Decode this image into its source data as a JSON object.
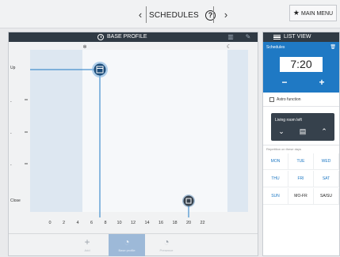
{
  "header": {
    "title": "SCHEDULES",
    "main_menu_label": "MAIN MENU",
    "prev_icon": "chevron-left-icon",
    "next_icon": "chevron-right-icon",
    "help_icon": "question-circle-icon",
    "star_icon": "star-icon"
  },
  "profile_panel": {
    "title": "BASE PROFILE",
    "y_labels": [
      "Up",
      "-",
      "-",
      "-",
      "Close"
    ],
    "x_labels": [
      "0",
      "2",
      "4",
      "6",
      "8",
      "10",
      "12",
      "14",
      "16",
      "18",
      "20",
      "22"
    ],
    "sun_icon": "sun-icon",
    "moon_icon": "moon-icon",
    "window_open_icon": "window-open-icon",
    "window_closed_icon": "window-closed-icon",
    "points": [
      {
        "hour": 7.2,
        "state": "Up"
      },
      {
        "hour": 20.0,
        "state": "Close"
      }
    ],
    "highlight_hour": 7.2,
    "colors": {
      "header_bg": "#303a44",
      "accent": "#1f79c4",
      "night_shade": "#dde7f1",
      "point_bg": "#1d4d7a"
    }
  },
  "bottom_toolbar": {
    "buttons": [
      {
        "icon": "plus-icon",
        "label": "Add"
      },
      {
        "icon": "base-profile-icon",
        "label": "Base profile",
        "active": true
      },
      {
        "icon": "presence-icon",
        "label": "Presence"
      }
    ]
  },
  "list_panel": {
    "title": "LIST VIEW",
    "schedules_label": "Schedules",
    "time_value": "7:20",
    "minus_label": "−",
    "plus_label": "+",
    "astro_label": "Astro function",
    "room": {
      "title": "Living room left",
      "down_icon": "chevron-down-icon",
      "stop_icon": "window-stop-icon",
      "up_icon": "chevron-up-icon"
    },
    "repetition_label": "Repetition on these days",
    "days": [
      "MON",
      "TUE",
      "WED",
      "THU",
      "FRI",
      "SAT",
      "SUN",
      "MO-FR",
      "SA/SU"
    ]
  }
}
